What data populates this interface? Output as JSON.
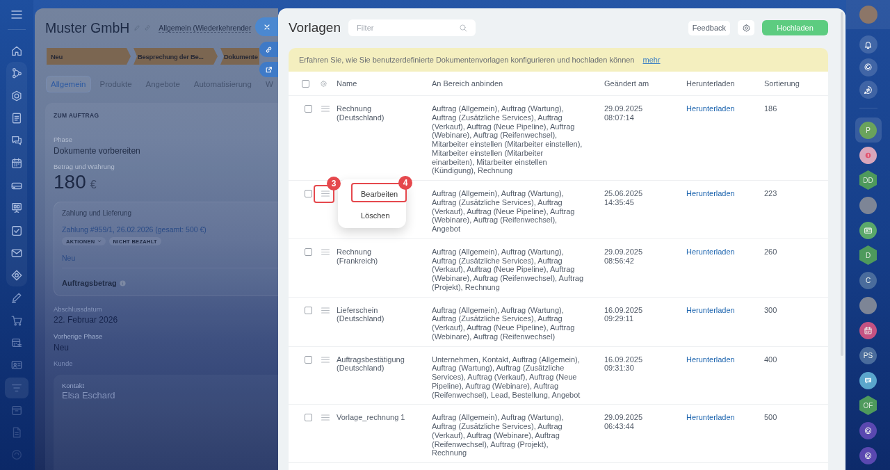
{
  "left_nav": {
    "items": [
      {
        "selected": false
      },
      {
        "selected": false
      },
      {
        "selected": false
      },
      {
        "selected": false
      },
      {
        "selected": false
      },
      {
        "selected": false
      },
      {
        "selected": false
      },
      {
        "selected": false
      },
      {
        "selected": false
      },
      {
        "selected": false
      },
      {
        "selected": false
      },
      {
        "selected": false
      },
      {
        "selected": false
      },
      {
        "selected": false
      },
      {
        "selected": false
      },
      {
        "selected": true
      },
      {
        "selected": false
      },
      {
        "selected": false
      },
      {
        "selected": false
      }
    ]
  },
  "deal": {
    "title": "Muster GmbH",
    "pipeline": "Allgemein (Wiederkehrender",
    "stages": [
      {
        "label": "Neu"
      },
      {
        "label": "Besprechung der Be..."
      },
      {
        "label": "Dokumente"
      }
    ],
    "tabs": [
      {
        "label": "Allgemein",
        "selected": true
      },
      {
        "label": "Produkte",
        "selected": false
      },
      {
        "label": "Angebote",
        "selected": false
      },
      {
        "label": "Automatisierung",
        "selected": false
      },
      {
        "label": "W",
        "selected": false
      }
    ],
    "section_title": "ZUM AUFTRAG",
    "phase": {
      "label": "Phase",
      "value": "Dokumente vorbereiten"
    },
    "amount": {
      "label": "Betrag und Währung",
      "value": "180",
      "currency": "€"
    },
    "payment": {
      "title": "Zahlung und Lieferung",
      "link": "Zahlung #959/1, 26.02.2026 (gesamt: 500 €)",
      "actions": "AKTIONEN",
      "status": "NICHT BEZAHLT",
      "stage": "Neu",
      "total_label": "Auftragsbetrag"
    },
    "close_date": {
      "label": "Abschlussdatum",
      "value": "22. Februar 2026"
    },
    "previous_phase": {
      "label": "Vorherige Phase",
      "value": "Neu"
    },
    "client": {
      "label": "Kunde",
      "contact_label": "Kontakt",
      "contact_name": "Elsa Eschard"
    }
  },
  "templates": {
    "title": "Vorlagen",
    "filter": {
      "placeholder": "Filter"
    },
    "feedback": "Feedback",
    "upload": "Hochladen",
    "banner": {
      "text": "Erfahren Sie, wie Sie benutzerdefinierte Dokumentenvorlagen konfigurieren und hochladen können",
      "link": "mehr"
    },
    "table": {
      "header_checked": false,
      "columns": [
        "Name",
        "An Bereich anbinden",
        "Geändert am",
        "Herunterladen",
        "Sortierung"
      ],
      "rows": [
        {
          "checked": false,
          "name": "Rechnung (Deutschland)",
          "areas": "Auftrag (Allgemein), Auftrag (Wartung), Auftrag (Zusätzliche Services), Auftrag (Verkauf), Auftrag (Neue Pipeline), Auftrag (Webinare), Auftrag (Reifenwechsel), Mitarbeiter einstellen (Mitarbeiter einstellen), Mitarbeiter einstellen (Mitarbeiter einarbeiten), Mitarbeiter einstellen (Kündigung), Rechnung",
          "modified": "29.09.2025 08:07:14",
          "download": "Herunterladen",
          "sort": "186"
        },
        {
          "checked": false,
          "context_menu": {
            "items": [
              "Bearbeiten",
              "Löschen"
            ]
          },
          "areas": "Auftrag (Allgemein), Auftrag (Wartung), Auftrag (Zusätzliche Services), Auftrag (Verkauf), Auftrag (Neue Pipeline), Auftrag (Webinare), Auftrag (Reifenwechsel), Angebot",
          "modified": "25.06.2025 14:35:45",
          "download": "Herunterladen",
          "sort": "223"
        },
        {
          "checked": false,
          "name": "Rechnung (Frankreich)",
          "areas": "Auftrag (Allgemein), Auftrag (Wartung), Auftrag (Zusätzliche Services), Auftrag (Verkauf), Auftrag (Neue Pipeline), Auftrag (Webinare), Auftrag (Reifenwechsel), Auftrag (Projekt), Rechnung",
          "modified": "29.09.2025 08:56:42",
          "download": "Herunterladen",
          "sort": "260"
        },
        {
          "checked": false,
          "name": "Lieferschein (Deutschland)",
          "areas": "Auftrag (Allgemein), Auftrag (Wartung), Auftrag (Zusätzliche Services), Auftrag (Verkauf), Auftrag (Neue Pipeline), Auftrag (Webinare), Auftrag (Reifenwechsel)",
          "modified": "16.09.2025 09:29:11",
          "download": "Herunterladen",
          "sort": "300"
        },
        {
          "checked": false,
          "name": "Auftragsbestätigung (Deutschland)",
          "areas": "Unternehmen, Kontakt, Auftrag (Allgemein), Auftrag (Wartung), Auftrag (Zusätzliche Services), Auftrag (Verkauf), Auftrag (Neue Pipeline), Auftrag (Webinare), Auftrag (Reifenwechsel), Lead, Bestellung, Angebot",
          "modified": "16.09.2025 09:31:30",
          "download": "Herunterladen",
          "sort": "400"
        },
        {
          "checked": false,
          "name": "Vorlage_rechnung 1",
          "areas": "Auftrag (Allgemein), Auftrag (Wartung), Auftrag (Zusätzliche Services), Auftrag (Verkauf), Auftrag (Webinare), Auftrag (Reifenwechsel), Auftrag (Projekt), Rechnung",
          "modified": "29.09.2025 06:43:44",
          "download": "Herunterladen",
          "sort": "500"
        }
      ]
    },
    "annotations": [
      {
        "label": "3"
      },
      {
        "label": "4"
      }
    ]
  },
  "right_bar": {
    "items": [
      {
        "kind": "letters",
        "label": "P",
        "color": "#6aa35c",
        "selected": true
      },
      {
        "kind": "icon",
        "color": "#d9a6bb",
        "selected": false
      },
      {
        "kind": "hexagon",
        "label": "DD",
        "color": "#4e9a5c",
        "selected": false
      },
      {
        "kind": "photo",
        "selected": false
      },
      {
        "kind": "icon",
        "color": "#5aa86a",
        "selected": false
      },
      {
        "kind": "hexagon",
        "label": "D",
        "color": "#4e9a5c",
        "selected": false
      },
      {
        "kind": "letters",
        "label": "C",
        "color": "#4a6c9c",
        "selected": false
      },
      {
        "kind": "photo",
        "selected": false
      },
      {
        "kind": "icon",
        "color": "#c45282",
        "selected": false
      },
      {
        "kind": "letters",
        "label": "PS",
        "color": "#4a6c9c",
        "selected": false
      },
      {
        "kind": "icon",
        "color": "#5aa6cc",
        "selected": false
      },
      {
        "kind": "hexagon",
        "label": "OF",
        "color": "#4e9a5c",
        "selected": false
      },
      {
        "kind": "icon",
        "color": "#5a48b0",
        "selected": false
      },
      {
        "kind": "icon",
        "color": "#5a48b0",
        "selected": false
      }
    ]
  }
}
